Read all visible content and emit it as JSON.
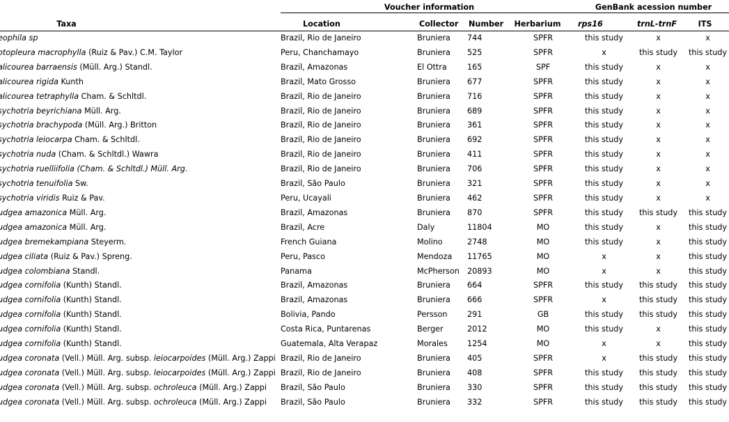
{
  "table": {
    "group_headers": [
      {
        "label": "",
        "span": 1,
        "ruled": false
      },
      {
        "label": "Voucher information",
        "span": 4,
        "ruled": true
      },
      {
        "label": "GenBank acession number",
        "span": 3,
        "ruled": true
      }
    ],
    "columns": [
      {
        "key": "taxa",
        "label": "Taxa",
        "style": "bold"
      },
      {
        "key": "location",
        "label": "Location",
        "style": "bold"
      },
      {
        "key": "collector",
        "label": "Collector",
        "style": "bold"
      },
      {
        "key": "number",
        "label": "Number",
        "style": "bold"
      },
      {
        "key": "herbarium",
        "label": "Herbarium",
        "style": "bold"
      },
      {
        "key": "rps16",
        "label": "rps16",
        "style": "bold-italic"
      },
      {
        "key": "trnl_trnf",
        "label": "trnL-trnF",
        "style": "bold-italic"
      },
      {
        "key": "its",
        "label": "ITS",
        "style": "bold"
      }
    ],
    "rows": [
      {
        "taxa_html": "<span class=\"it\">eophila sp</span>",
        "taxa_text": "eophila sp",
        "location": "Brazil, Rio de Janeiro",
        "collector": "Bruniera",
        "number": "744",
        "herbarium": "SPFR",
        "rps16": "this study",
        "trnl_trnf": "x",
        "its": "x"
      },
      {
        "taxa_html": "<span class=\"it\">otopleura macrophylla</span> (Ruiz &amp; Pav.) C.M. Taylor",
        "taxa_text": "otopleura macrophylla (Ruiz & Pav.) C.M. Taylor",
        "location": "Peru, Chanchamayo",
        "collector": "Bruniera",
        "number": "525",
        "herbarium": "SPFR",
        "rps16": "x",
        "trnl_trnf": "this study",
        "its": "this study"
      },
      {
        "taxa_html": "<span class=\"it\">alicourea barraensis</span> (Müll. Arg.) Standl.",
        "taxa_text": "alicourea barraensis (Müll. Arg.) Standl.",
        "location": "Brazil, Amazonas",
        "collector": "El Ottra",
        "number": "165",
        "herbarium": "SPF",
        "rps16": "this study",
        "trnl_trnf": "x",
        "its": "x"
      },
      {
        "taxa_html": "<span class=\"it\">alicourea rigida</span> Kunth",
        "taxa_text": "alicourea rigida Kunth",
        "location": "Brazil, Mato Grosso",
        "collector": "Bruniera",
        "number": "677",
        "herbarium": "SPFR",
        "rps16": "this study",
        "trnl_trnf": "x",
        "its": "x"
      },
      {
        "taxa_html": "<span class=\"it\">alicourea tetraphylla</span> Cham. &amp; Schltdl.",
        "taxa_text": "alicourea tetraphylla Cham. & Schltdl.",
        "location": "Brazil, Rio de Janeiro",
        "collector": "Bruniera",
        "number": "716",
        "herbarium": "SPFR",
        "rps16": "this study",
        "trnl_trnf": "x",
        "its": "x"
      },
      {
        "taxa_html": "<span class=\"it\">sychotria beyrichiana</span> Müll. Arg.",
        "taxa_text": "sychotria beyrichiana Müll. Arg.",
        "location": "Brazil, Rio de Janeiro",
        "collector": "Bruniera",
        "number": "689",
        "herbarium": "SPFR",
        "rps16": "this study",
        "trnl_trnf": "x",
        "its": "x"
      },
      {
        "taxa_html": "<span class=\"it\">sychotria brachypoda</span> (Müll. Arg.) Britton",
        "taxa_text": "sychotria brachypoda (Müll. Arg.) Britton",
        "location": "Brazil, Rio de Janeiro",
        "collector": "Bruniera",
        "number": "361",
        "herbarium": "SPFR",
        "rps16": "this study",
        "trnl_trnf": "x",
        "its": "x"
      },
      {
        "taxa_html": "<span class=\"it\">sychotria leiocarpa</span> Cham. &amp; Schltdl.",
        "taxa_text": "sychotria leiocarpa Cham. & Schltdl.",
        "location": "Brazil, Rio de Janeiro",
        "collector": "Bruniera",
        "number": "692",
        "herbarium": "SPFR",
        "rps16": "this study",
        "trnl_trnf": "x",
        "its": "x"
      },
      {
        "taxa_html": "<span class=\"it\">sychotria nuda</span> (Cham. &amp; Schltdl.) Wawra",
        "taxa_text": "sychotria nuda (Cham. & Schltdl.) Wawra",
        "location": "Brazil, Rio de Janeiro",
        "collector": "Bruniera",
        "number": "411",
        "herbarium": "SPFR",
        "rps16": "this study",
        "trnl_trnf": "x",
        "its": "x"
      },
      {
        "taxa_html": "<span class=\"it\">sychotria ruelliifolia (Cham. &amp; Schltdl.) Müll. Arg.</span>",
        "taxa_text": "sychotria ruelliifolia (Cham. & Schltdl.) Müll. Arg.",
        "location": "Brazil, Rio de Janeiro",
        "collector": "Bruniera",
        "number": "706",
        "herbarium": "SPFR",
        "rps16": "this study",
        "trnl_trnf": "x",
        "its": "x"
      },
      {
        "taxa_html": "<span class=\"it\">sychotria tenuifolia</span> Sw.",
        "taxa_text": "sychotria tenuifolia Sw.",
        "location": "Brazil, São Paulo",
        "collector": "Bruniera",
        "number": "321",
        "herbarium": "SPFR",
        "rps16": "this study",
        "trnl_trnf": "x",
        "its": "x"
      },
      {
        "taxa_html": "<span class=\"it\">sychotria viridis</span> Ruiz &amp; Pav.",
        "taxa_text": "sychotria viridis Ruiz & Pav.",
        "location": "Peru, Ucayali",
        "collector": "Bruniera",
        "number": "462",
        "herbarium": "SPFR",
        "rps16": "this study",
        "trnl_trnf": "x",
        "its": "x"
      },
      {
        "taxa_html": "<span class=\"it\">udgea amazonica</span> Müll. Arg.",
        "taxa_text": "udgea amazonica Müll. Arg.",
        "location": "Brazil, Amazonas",
        "collector": "Bruniera",
        "number": "870",
        "herbarium": "SPFR",
        "rps16": "this study",
        "trnl_trnf": "this study",
        "its": "this study"
      },
      {
        "taxa_html": "<span class=\"it\">udgea amazonica</span> Müll. Arg.",
        "taxa_text": "udgea amazonica Müll. Arg.",
        "location": "Brazil, Acre",
        "collector": "Daly",
        "number": "11804",
        "herbarium": "MO",
        "rps16": "this study",
        "trnl_trnf": "x",
        "its": "this study"
      },
      {
        "taxa_html": "<span class=\"it\">udgea bremekampiana</span> Steyerm.",
        "taxa_text": "udgea bremekampiana Steyerm.",
        "location": "French Guiana",
        "collector": "Molino",
        "number": "2748",
        "herbarium": "MO",
        "rps16": "this study",
        "trnl_trnf": "x",
        "its": "this study"
      },
      {
        "taxa_html": "<span class=\"it\">udgea ciliata</span> (Ruiz &amp; Pav.) Spreng.",
        "taxa_text": "udgea ciliata (Ruiz & Pav.) Spreng.",
        "location": "Peru, Pasco",
        "collector": "Mendoza",
        "number": "11765",
        "herbarium": "MO",
        "rps16": "x",
        "trnl_trnf": "x",
        "its": "this study"
      },
      {
        "taxa_html": "<span class=\"it\">udgea colombiana</span> Standl.",
        "taxa_text": "udgea colombiana Standl.",
        "location": "Panama",
        "collector": "McPherson",
        "number": "20893",
        "herbarium": "MO",
        "rps16": "x",
        "trnl_trnf": "x",
        "its": "this study"
      },
      {
        "taxa_html": "<span class=\"it\">udgea cornifolia</span> (Kunth) Standl.",
        "taxa_text": "udgea cornifolia (Kunth) Standl.",
        "location": "Brazil, Amazonas",
        "collector": "Bruniera",
        "number": "664",
        "herbarium": "SPFR",
        "rps16": "this study",
        "trnl_trnf": "this study",
        "its": "this study"
      },
      {
        "taxa_html": "<span class=\"it\">udgea cornifolia</span> (Kunth) Standl.",
        "taxa_text": "udgea cornifolia (Kunth) Standl.",
        "location": "Brazil, Amazonas",
        "collector": "Bruniera",
        "number": "666",
        "herbarium": "SPFR",
        "rps16": "x",
        "trnl_trnf": "this study",
        "its": "this study"
      },
      {
        "taxa_html": "<span class=\"it\">udgea cornifolia</span> (Kunth) Standl.",
        "taxa_text": "udgea cornifolia (Kunth) Standl.",
        "location": "Bolivia, Pando",
        "collector": "Persson",
        "number": "291",
        "herbarium": "GB",
        "rps16": "this study",
        "trnl_trnf": "this study",
        "its": "this study"
      },
      {
        "taxa_html": "<span class=\"it\">udgea cornifolia</span> (Kunth) Standl.",
        "taxa_text": "udgea cornifolia (Kunth) Standl.",
        "location": "Costa Rica, Puntarenas",
        "collector": "Berger",
        "number": "2012",
        "herbarium": "MO",
        "rps16": "this study",
        "trnl_trnf": "x",
        "its": "this study"
      },
      {
        "taxa_html": "<span class=\"it\">udgea cornifolia</span> (Kunth) Standl.",
        "taxa_text": "udgea cornifolia (Kunth) Standl.",
        "location": "Guatemala, Alta Verapaz",
        "collector": "Morales",
        "number": "1254",
        "herbarium": "MO",
        "rps16": "x",
        "trnl_trnf": "x",
        "its": "this study"
      },
      {
        "taxa_html": "<span class=\"it\">udgea coronata</span> (Vell.) Müll. Arg. subsp. <span class=\"it\">leiocarpoides</span> (Müll. Arg.) Zappi",
        "taxa_text": "udgea coronata (Vell.) Müll. Arg. subsp. leiocarpoides (Müll. Arg.) Zappi",
        "location": "Brazil, Rio de Janeiro",
        "collector": "Bruniera",
        "number": "405",
        "herbarium": "SPFR",
        "rps16": "x",
        "trnl_trnf": "this study",
        "its": "this study"
      },
      {
        "taxa_html": "<span class=\"it\">udgea coronata</span> (Vell.) Müll. Arg. subsp. <span class=\"it\">leiocarpoides</span> (Müll. Arg.) Zappi",
        "taxa_text": "udgea coronata (Vell.) Müll. Arg. subsp. leiocarpoides (Müll. Arg.) Zappi",
        "location": "Brazil, Rio de Janeiro",
        "collector": "Bruniera",
        "number": "408",
        "herbarium": "SPFR",
        "rps16": "this study",
        "trnl_trnf": "this study",
        "its": "this study"
      },
      {
        "taxa_html": "<span class=\"it\">udgea coronata</span> (Vell.) Müll. Arg. subsp. <span class=\"it\">ochroleuca</span> (Müll. Arg.) Zappi",
        "taxa_text": "udgea coronata (Vell.) Müll. Arg. subsp. ochroleuca (Müll. Arg.) Zappi",
        "location": "Brazil, São Paulo",
        "collector": "Bruniera",
        "number": "330",
        "herbarium": "SPFR",
        "rps16": "this study",
        "trnl_trnf": "this study",
        "its": "this study"
      },
      {
        "taxa_html": "<span class=\"it\">udgea coronata</span> (Vell.) Müll. Arg. subsp. <span class=\"it\">ochroleuca</span> (Müll. Arg.) Zappi",
        "taxa_text": "udgea coronata (Vell.) Müll. Arg. subsp. ochroleuca (Müll. Arg.) Zappi",
        "location": "Brazil, São Paulo",
        "collector": "Bruniera",
        "number": "332",
        "herbarium": "SPFR",
        "rps16": "this study",
        "trnl_trnf": "this study",
        "its": "this study"
      }
    ]
  }
}
